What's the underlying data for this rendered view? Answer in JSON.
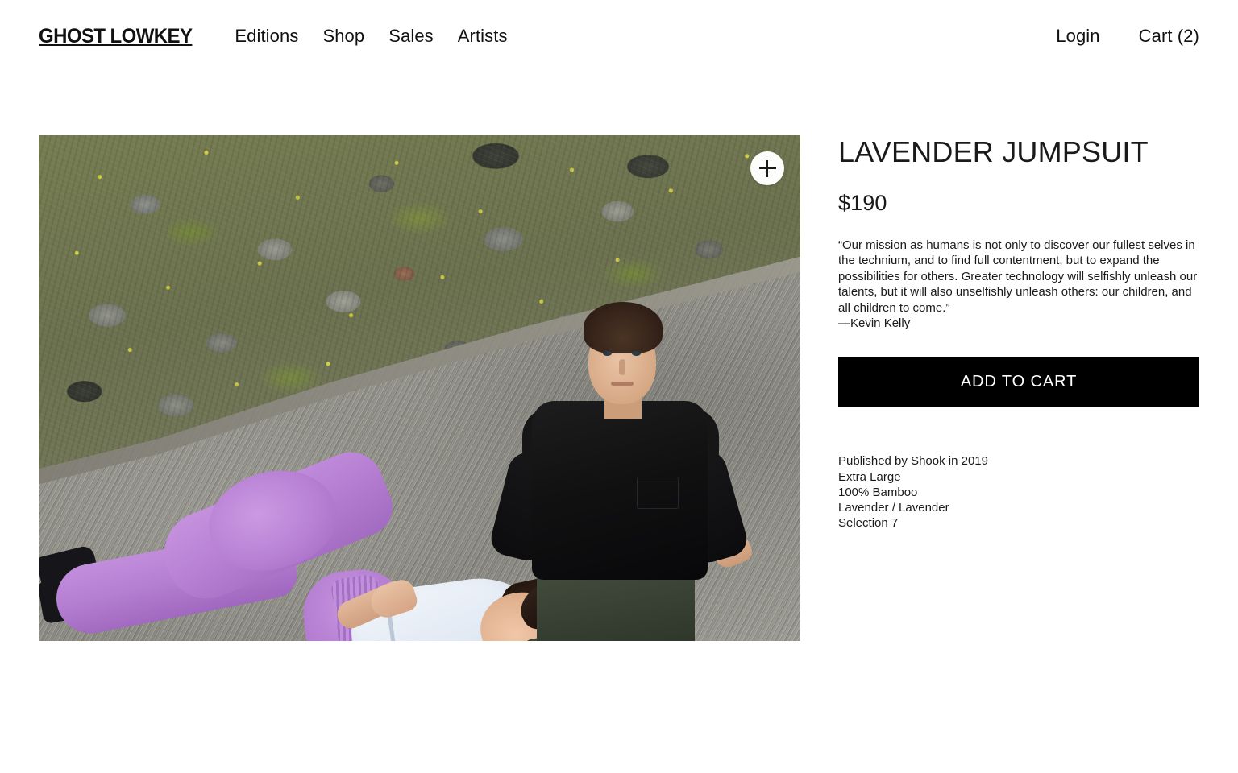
{
  "header": {
    "brand": "GHOST LOWKEY",
    "nav": [
      {
        "label": "Editions"
      },
      {
        "label": "Shop"
      },
      {
        "label": "Sales"
      },
      {
        "label": "Artists"
      }
    ],
    "login_label": "Login",
    "cart_label": "Cart (2)"
  },
  "gallery": {
    "zoom_icon": "plus-icon",
    "alt": "Two models on a concrete path beside a rocky wildflower slope; woman lying in lavender jumpsuit and white shirt, man seated in black long-sleeve tee and olive shorts"
  },
  "product": {
    "title": "LAVENDER JUMPSUIT",
    "price": "$190",
    "description": "“Our mission as humans is not only to discover our fullest selves in the technium, and to find full contentment, but to expand the possibilities for others. Greater technology will selfishly unleash our talents, but it will also unselfishly unleash others: our children, and all children to come.”",
    "attribution": "—Kevin Kelly",
    "add_to_cart_label": "ADD TO CART",
    "meta": [
      "Published by Shook in 2019",
      "Extra Large",
      "100% Bamboo",
      "Lavender / Lavender",
      "Selection 7"
    ]
  },
  "colors": {
    "accent": "#000000",
    "text": "#1a1a1a",
    "background": "#ffffff",
    "lavender": "#b87fd4"
  }
}
